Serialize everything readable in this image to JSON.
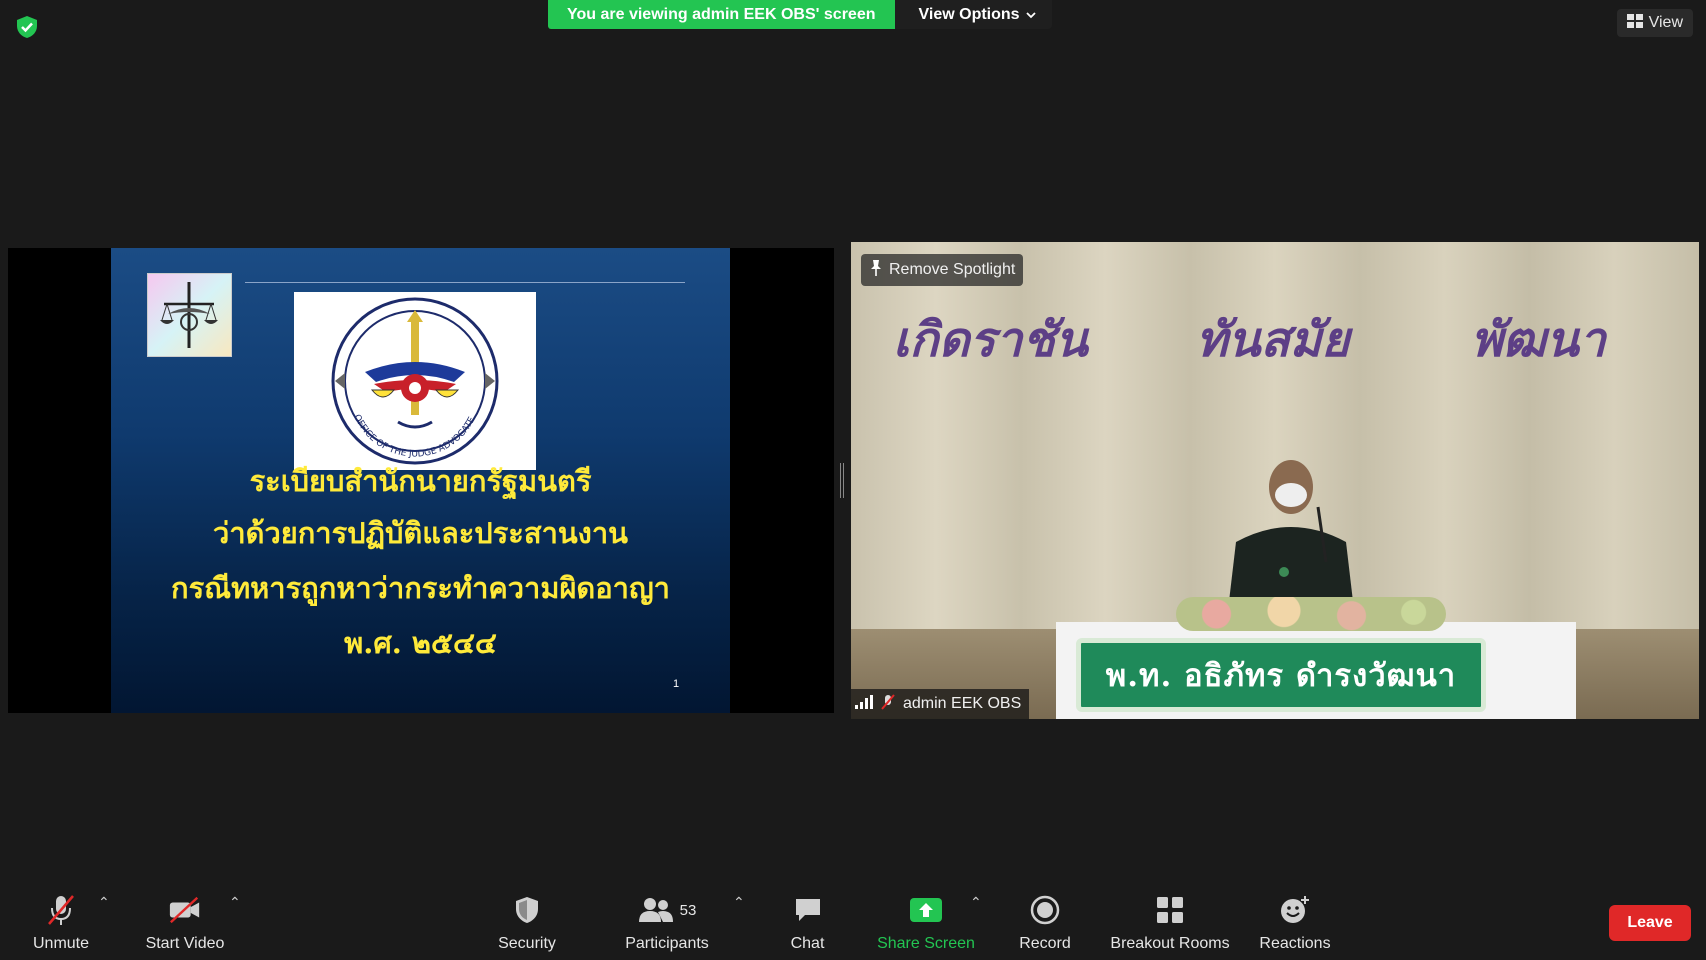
{
  "banner": {
    "viewing_text": "You are viewing admin EEK OBS' screen",
    "view_options_label": "View Options"
  },
  "top_right": {
    "view_label": "View"
  },
  "slide": {
    "line1": "ระเบียบสำนักนายกรัฐมนตรี",
    "line2": "ว่าด้วยการปฏิบัติและประสานงาน",
    "line3": "กรณีทหารถูกหาว่ากระทำความผิดอาญา",
    "line4": "พ.ศ. ๒๕๔๔",
    "page_number": "1",
    "logo_text": "OFFICE OF THE JUDGE ADVOCATE"
  },
  "video": {
    "remove_spotlight_label": "Remove Spotlight",
    "participant_name": "admin EEK OBS",
    "wall_words": [
      "เกิดราชัน",
      "ทันสมัย",
      "พัฒนา"
    ],
    "nameplate": "พ.ท. อธิภัทร ดำรงวัฒนา"
  },
  "toolbar": {
    "unmute": "Unmute",
    "start_video": "Start Video",
    "security": "Security",
    "participants": "Participants",
    "participants_count": "53",
    "chat": "Chat",
    "share_screen": "Share Screen",
    "record": "Record",
    "breakout_rooms": "Breakout Rooms",
    "reactions": "Reactions",
    "leave": "Leave"
  },
  "colors": {
    "share_green": "#23c552",
    "leave_red": "#e02828",
    "slide_text_yellow": "#ffea3a",
    "nameplate_green": "#1f8a5a"
  }
}
